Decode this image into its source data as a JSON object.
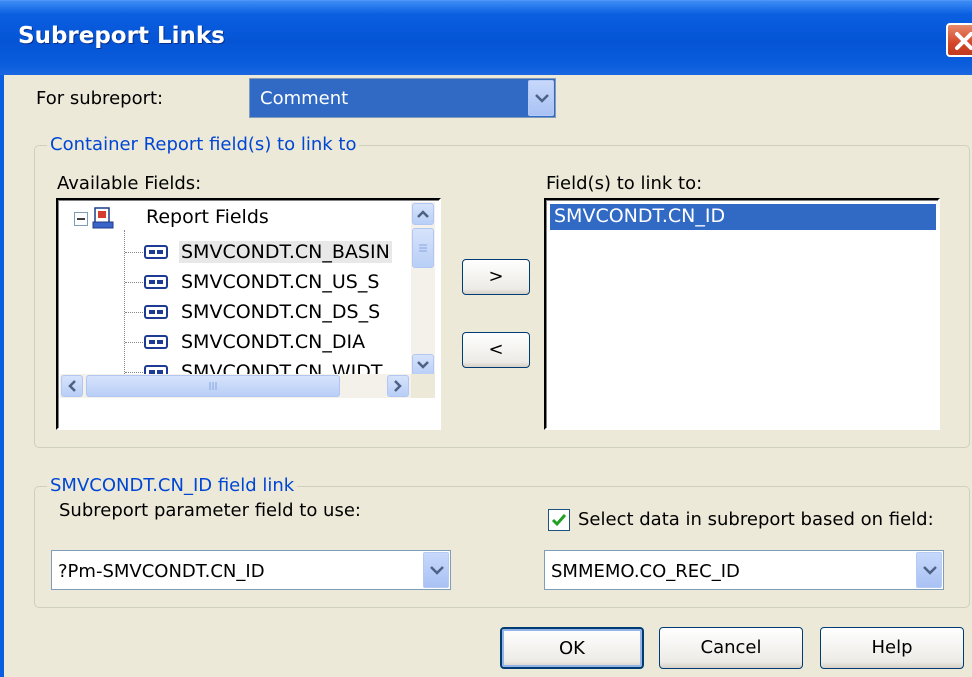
{
  "window": {
    "title": "Subreport Links"
  },
  "for_subreport": {
    "label": "For subreport:",
    "value": "Comment"
  },
  "container_group": {
    "title": "Container Report field(s) to link to",
    "available_label": "Available Fields:",
    "tree_root": "Report Fields",
    "fields": [
      "SMVCONDT.CN_BASIN",
      "SMVCONDT.CN_US_S",
      "SMVCONDT.CN_DS_S",
      "SMVCONDT.CN_DIA",
      "SMVCONDT.CN_WIDT"
    ],
    "add_label": ">",
    "remove_label": "<",
    "link_label": "Field(s) to link to:",
    "linked": [
      "SMVCONDT.CN_ID"
    ]
  },
  "field_link_group": {
    "title": "SMVCONDT.CN_ID field link",
    "param_label": "Subreport parameter field to use:",
    "param_value": "?Pm-SMVCONDT.CN_ID",
    "select_data_label": "Select data in subreport based on field:",
    "select_data_checked": true,
    "select_data_value": "SMMEMO.CO_REC_ID"
  },
  "buttons": {
    "ok": "OK",
    "cancel": "Cancel",
    "help": "Help"
  },
  "icons": [
    "close-icon",
    "tree-collapse-icon",
    "report-fields-icon",
    "field-icon",
    "dropdown-arrow-icon",
    "checkmark-icon"
  ]
}
